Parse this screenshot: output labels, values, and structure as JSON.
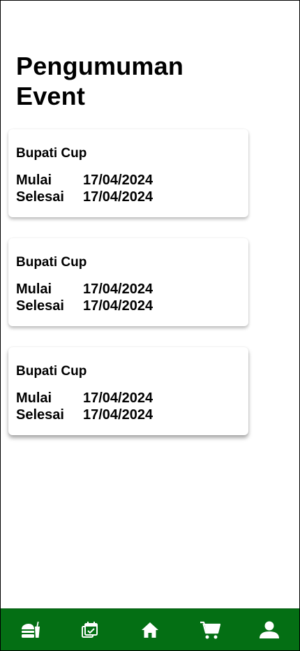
{
  "page": {
    "title": "Pengumuman Event"
  },
  "events": [
    {
      "name": "Bupati Cup",
      "start_label": "Mulai",
      "start_date": "17/04/2024",
      "end_label": "Selesai",
      "end_date": "17/04/2024"
    },
    {
      "name": "Bupati Cup",
      "start_label": "Mulai",
      "start_date": "17/04/2024",
      "end_label": "Selesai",
      "end_date": "17/04/2024"
    },
    {
      "name": "Bupati Cup",
      "start_label": "Mulai",
      "start_date": "17/04/2024",
      "end_label": "Selesai",
      "end_date": "17/04/2024"
    }
  ],
  "nav": {
    "background": "#046f14",
    "items": [
      {
        "icon": "fastfood-icon"
      },
      {
        "icon": "event-calendar-icon"
      },
      {
        "icon": "home-icon"
      },
      {
        "icon": "cart-icon"
      },
      {
        "icon": "profile-icon"
      }
    ]
  }
}
